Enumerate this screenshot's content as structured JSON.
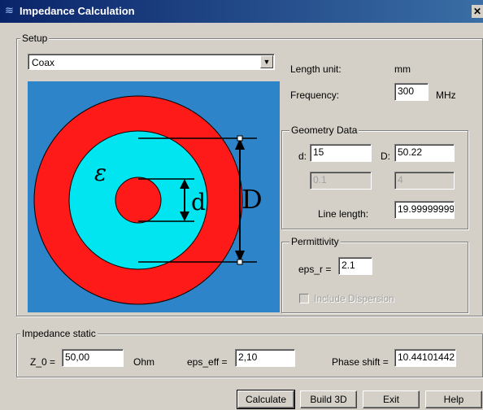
{
  "window": {
    "title": "Impedance Calculation",
    "close_glyph": "✕"
  },
  "setup": {
    "legend": "Setup",
    "line_type": "Coax",
    "length_unit_label": "Length unit:",
    "length_unit_value": "mm",
    "frequency_label": "Frequency:",
    "frequency_value": "300",
    "frequency_unit": "MHz"
  },
  "figure": {
    "epsilon_symbol": "ε",
    "inner_label": "d",
    "outer_label": "D",
    "colors": {
      "background": "#2e84c9",
      "outer": "#ff1a1a",
      "dielectric": "#00e5ef"
    }
  },
  "geometry": {
    "legend": "Geometry Data",
    "d_label": "d:",
    "d_value": "15",
    "D_label": "D:",
    "D_value": "50.22",
    "tol_left": "0.1",
    "tol_right": "4",
    "line_length_label": "Line length:",
    "line_length_value": "19.99999999"
  },
  "permittivity": {
    "legend": "Permittivity",
    "eps_r_label": "eps_r =",
    "eps_r_value": "2.1",
    "dispersion_label": "Include Dispersion"
  },
  "impedance": {
    "legend": "Impedance static",
    "z0_label": "Z_0 =",
    "z0_value": "50,00",
    "z0_unit": "Ohm",
    "eps_eff_label": "eps_eff =",
    "eps_eff_value": "2,10",
    "phase_label": "Phase shift =",
    "phase_value": "10.44101442"
  },
  "buttons": {
    "calculate": "Calculate",
    "build3d": "Build 3D",
    "exit": "Exit",
    "help": "Help"
  }
}
